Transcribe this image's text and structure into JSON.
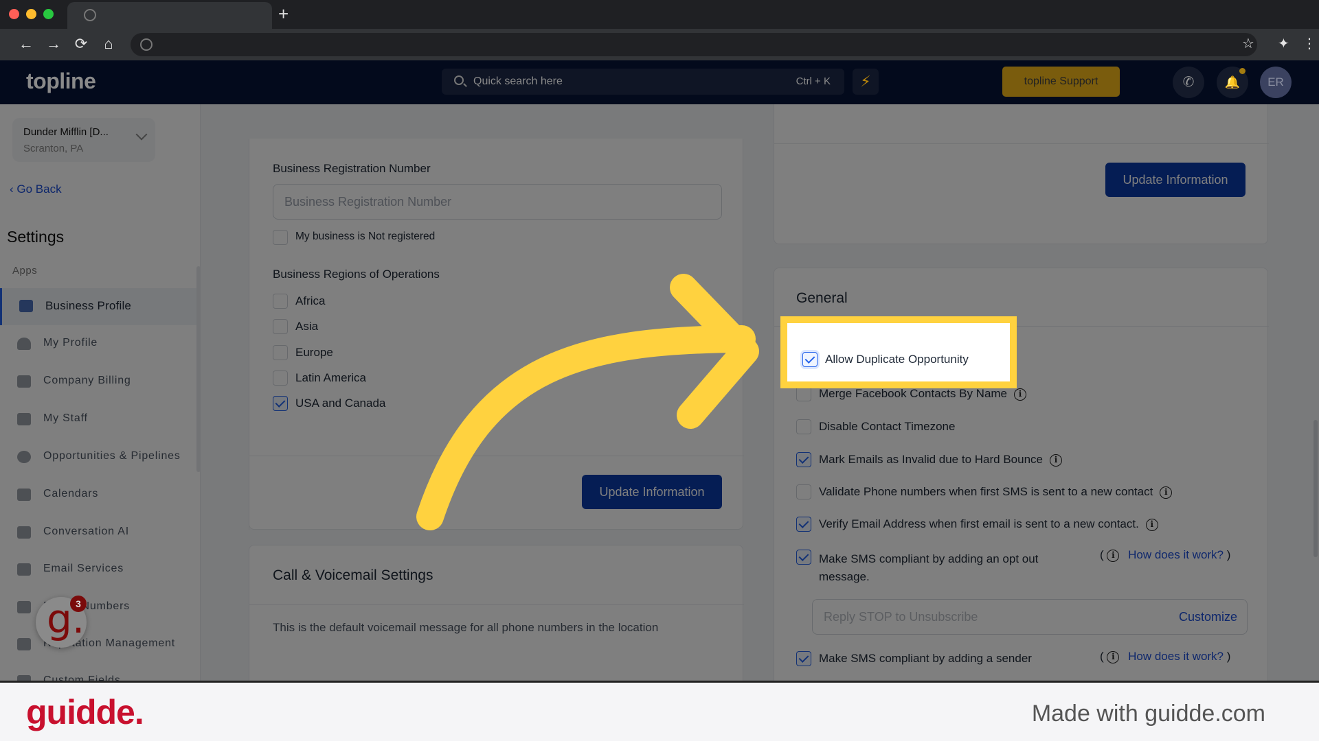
{
  "browser": {
    "new_tab_label": "+",
    "nav": {
      "back": "←",
      "forward": "→",
      "reload": "⟳",
      "home": "⌂"
    },
    "toolbar_right": {
      "bookmark": "☆",
      "extensions": "✦",
      "menu": "⋮"
    }
  },
  "header": {
    "logo": "topline",
    "search_placeholder": "Quick search here",
    "search_shortcut": "Ctrl + K",
    "bolt_icon": "⚡",
    "support_label": "topline Support",
    "phone_icon": "✆",
    "bell_icon": "🔔",
    "avatar_initials": "ER"
  },
  "sidebar": {
    "account_name": "Dunder Mifflin [D...",
    "account_location": "Scranton, PA",
    "go_back": "Go Back",
    "title": "Settings",
    "section_label": "Apps",
    "items": [
      {
        "label": "Business Profile",
        "active": true
      },
      {
        "label": "My Profile"
      },
      {
        "label": "Company Billing"
      },
      {
        "label": "My Staff"
      },
      {
        "label": "Opportunities & Pipelines"
      },
      {
        "label": "Calendars"
      },
      {
        "label": "Conversation AI"
      },
      {
        "label": "Email Services"
      },
      {
        "label": "Phone Numbers"
      },
      {
        "label": "Reputation Management"
      },
      {
        "label": "Custom Fields"
      }
    ]
  },
  "business_info": {
    "reg_number_label": "Business Registration Number",
    "reg_number_placeholder": "Business Registration Number",
    "not_registered_label": "My business is Not registered",
    "not_registered_checked": false,
    "regions_label": "Business Regions of Operations",
    "regions": [
      {
        "label": "Africa",
        "checked": false
      },
      {
        "label": "Asia",
        "checked": false
      },
      {
        "label": "Europe",
        "checked": false
      },
      {
        "label": "Latin America",
        "checked": false
      },
      {
        "label": "USA and Canada",
        "checked": true
      }
    ],
    "update_button": "Update Information"
  },
  "call_voicemail": {
    "title": "Call & Voicemail Settings",
    "description": "This is the default voicemail message for all phone numbers in the location"
  },
  "right_top_card": {
    "update_button": "Update Information"
  },
  "general": {
    "title": "General",
    "options": [
      {
        "label": "Allow Duplicate Opportunity",
        "checked": true,
        "info": false
      },
      {
        "label": "Merge Facebook Contacts By Name",
        "checked": false,
        "info": true
      },
      {
        "label": "Disable Contact Timezone",
        "checked": false,
        "info": false
      },
      {
        "label": "Mark Emails as Invalid due to Hard Bounce",
        "checked": true,
        "info": true
      },
      {
        "label": "Validate Phone numbers when first SMS is sent to a new contact",
        "checked": false,
        "info": true
      },
      {
        "label": "Verify Email Address when first email is sent to a new contact.",
        "checked": true,
        "info": true
      },
      {
        "label": "Make SMS compliant by adding an opt out message.",
        "checked": true,
        "info": true,
        "how_link": "How does it work?"
      },
      {
        "label": "Make SMS compliant by adding a sender",
        "checked": true,
        "info": true,
        "how_link": "How does it work?"
      }
    ],
    "opt_out_line1": "Make SMS compliant by adding an opt out",
    "opt_out_line2": "message.",
    "opt_out_placeholder": "Reply STOP to Unsubscribe",
    "customize_label": "Customize",
    "how_link": "How does it work?",
    "info_glyph": "i"
  },
  "guidde": {
    "bubble_letter": "g.",
    "badge_count": "3",
    "brand": "guidde.",
    "made_with": "Made with guidde.com"
  },
  "colors": {
    "accent_blue": "#0b3aa8",
    "highlight_yellow": "#ffd23f",
    "guidde_red": "#c8102e",
    "support_gold": "#7a5c0d"
  }
}
